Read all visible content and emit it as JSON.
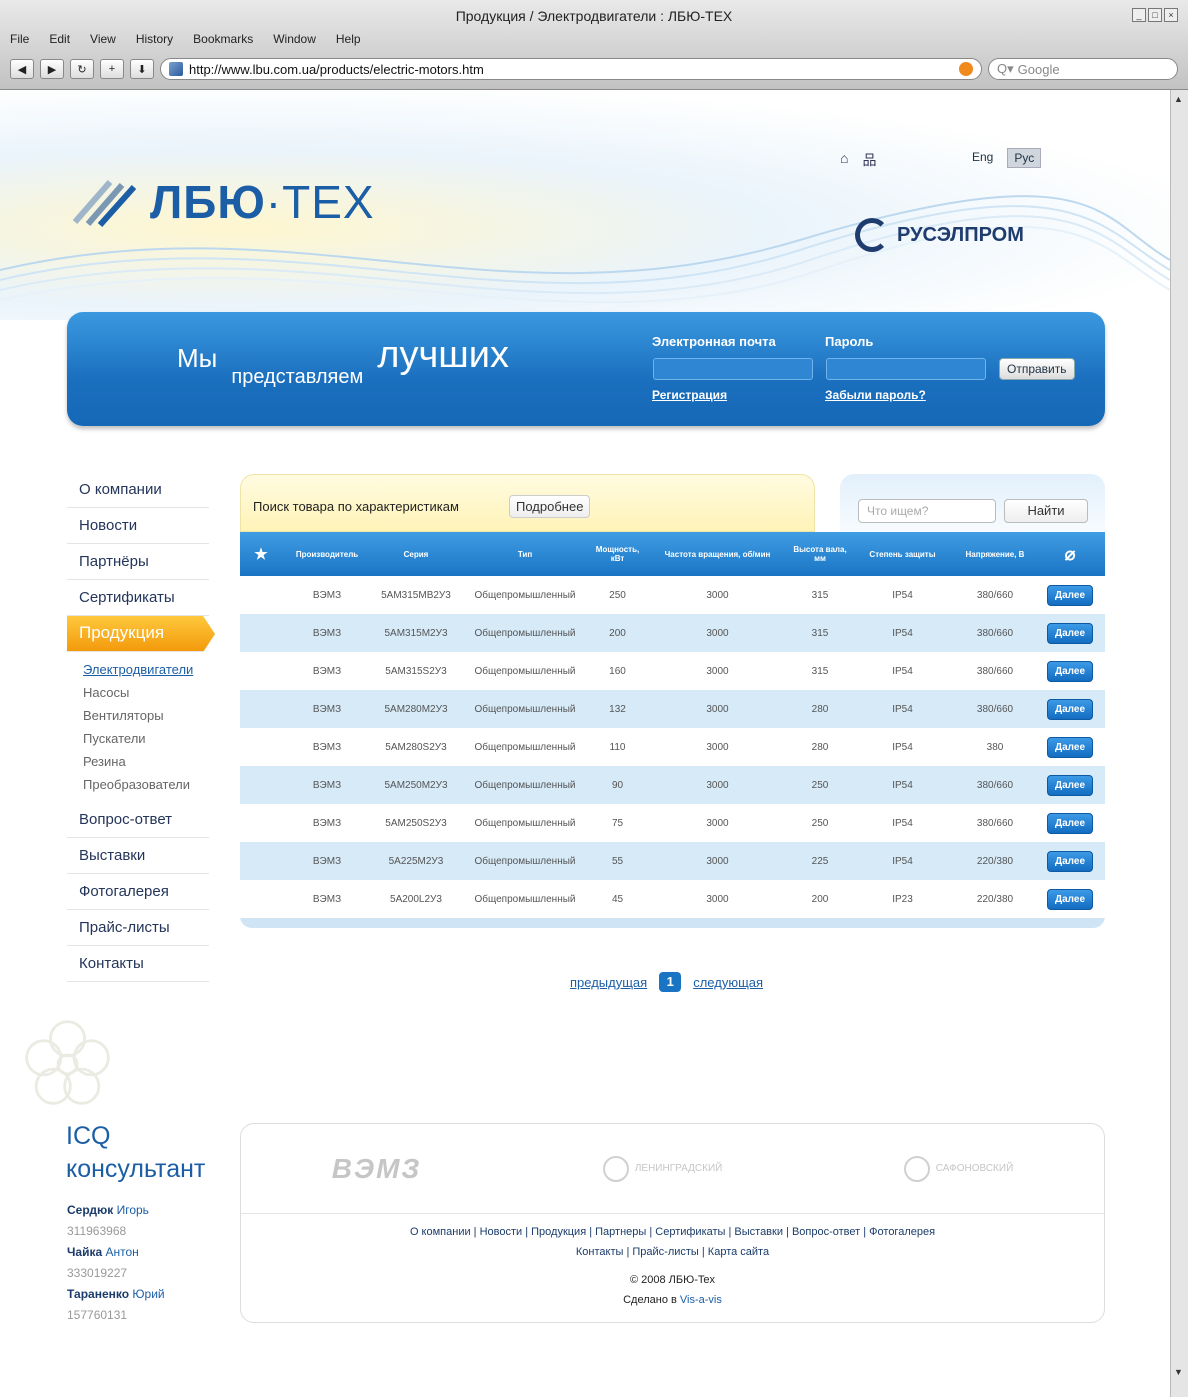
{
  "window": {
    "title": "Продукция / Электродвигатели : ЛБЮ-ТЕХ",
    "menu": [
      "File",
      "Edit",
      "View",
      "History",
      "Bookmarks",
      "Window",
      "Help"
    ],
    "url": "http://www.lbu.com.ua/products/electric-motors.htm",
    "search_placeholder": "Google"
  },
  "header": {
    "logo_bold": "ЛБЮ",
    "logo_rest": "·ТЕХ",
    "lang_eng": "Eng",
    "lang_rus": "Рус",
    "partner": "РУСЭЛПРОМ"
  },
  "banner": {
    "s1": "Мы",
    "s2": "представляем",
    "s3": "лучших",
    "email_label": "Электронная почта",
    "password_label": "Пароль",
    "send": "Отправить",
    "register": "Регистрация",
    "forgot": "Забыли пароль?"
  },
  "nav": {
    "items": [
      "О компании",
      "Новости",
      "Партнёры",
      "Сертификаты",
      "Продукция"
    ],
    "sub": [
      "Электродвигатели",
      "Насосы",
      "Вентиляторы",
      "Пускатели",
      "Резина",
      "Преобразователи"
    ],
    "items2": [
      "Вопрос-ответ",
      "Выставки",
      "Фотогалерея",
      "Прайс-листы",
      "Контакты"
    ]
  },
  "icq": {
    "title1": "ICQ",
    "title2": "консультант",
    "people": [
      {
        "last": "Сердюк",
        "first": "Игорь",
        "num": "311963968"
      },
      {
        "last": "Чайка",
        "first": "Антон",
        "num": "333019227"
      },
      {
        "last": "Тараненко",
        "first": "Юрий",
        "num": "157760131"
      }
    ]
  },
  "search": {
    "adv_label": "Поиск товара по характеристикам",
    "adv_btn": "Подробнее",
    "quick_placeholder": "Что ищем?",
    "quick_btn": "Найти"
  },
  "table": {
    "headers": [
      "Производитель",
      "Серия",
      "Тип",
      "Мощность, кВт",
      "Частота вращения, об/мин",
      "Высота вала, мм",
      "Степень защиты",
      "Напряжение, В"
    ],
    "more": "Далее",
    "rows": [
      [
        "ВЭМЗ",
        "5АМ315МВ2У3",
        "Общепромышленный",
        "250",
        "3000",
        "315",
        "IP54",
        "380/660"
      ],
      [
        "ВЭМЗ",
        "5АМ315М2У3",
        "Общепромышленный",
        "200",
        "3000",
        "315",
        "IP54",
        "380/660"
      ],
      [
        "ВЭМЗ",
        "5АМ315S2У3",
        "Общепромышленный",
        "160",
        "3000",
        "315",
        "IP54",
        "380/660"
      ],
      [
        "ВЭМЗ",
        "5АМ280М2У3",
        "Общепромышленный",
        "132",
        "3000",
        "280",
        "IP54",
        "380/660"
      ],
      [
        "ВЭМЗ",
        "5АМ280S2У3",
        "Общепромышленный",
        "110",
        "3000",
        "280",
        "IP54",
        "380"
      ],
      [
        "ВЭМЗ",
        "5АМ250М2У3",
        "Общепромышленный",
        "90",
        "3000",
        "250",
        "IP54",
        "380/660"
      ],
      [
        "ВЭМЗ",
        "5АМ250S2У3",
        "Общепромышленный",
        "75",
        "3000",
        "250",
        "IP54",
        "380/660"
      ],
      [
        "ВЭМЗ",
        "5А225М2У3",
        "Общепромышленный",
        "55",
        "3000",
        "225",
        "IP54",
        "220/380"
      ],
      [
        "ВЭМЗ",
        "5А200L2У3",
        "Общепромышленный",
        "45",
        "3000",
        "200",
        "IP23",
        "220/380"
      ]
    ]
  },
  "pager": {
    "prev": "предыдущая",
    "page": "1",
    "next": "следующая"
  },
  "footer": {
    "partner1": "ВЭМЗ",
    "partner2": "ЛЕНИНГРАДСКИЙ",
    "partner3": "САФОНОВСКИЙ",
    "links1": "О компании | Новости | Продукция | Партнеры | Сертификаты | Выставки | Вопрос-ответ | Фотогалерея",
    "links2": "Контакты | Прайс-листы | Карта сайта",
    "copyright": "© 2008 ЛБЮ-Tex",
    "made_prefix": "Сделано в ",
    "made_link": "Vis-a-vis"
  }
}
